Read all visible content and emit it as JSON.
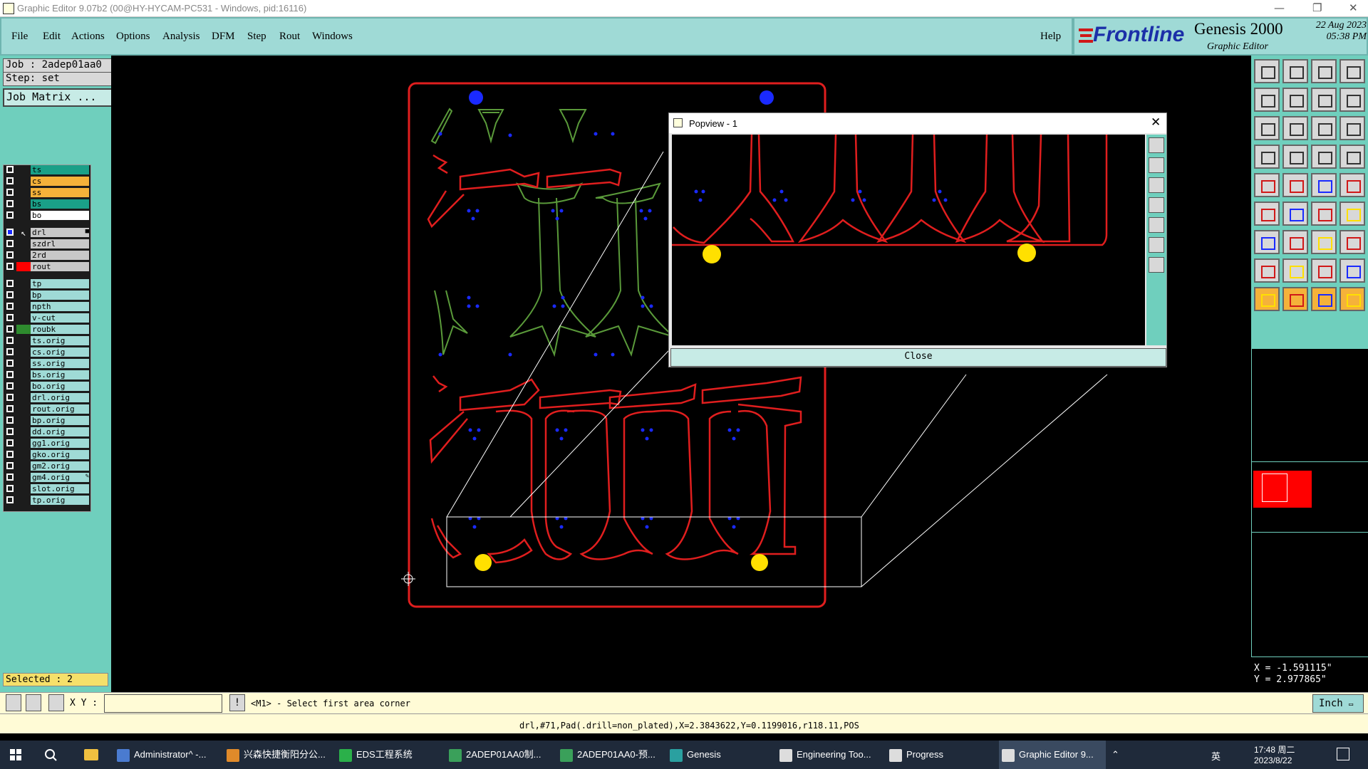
{
  "window": {
    "title": "Graphic Editor 9.07b2 (00@HY-HYCAM-PC531 - Windows, pid:16116)",
    "minimize": "—",
    "restore": "❐",
    "close": "✕"
  },
  "menu": {
    "items": [
      "File",
      "Edit",
      "Actions",
      "Options",
      "Analysis",
      "DFM",
      "Step",
      "Rout",
      "Windows"
    ],
    "help": "Help"
  },
  "brand": {
    "logo": "Frontline",
    "product": "Genesis 2000",
    "subtitle": "Graphic Editor",
    "date": "22 Aug 2023",
    "time": "05:38 PM"
  },
  "job": {
    "job_label": "Job : 2adep01aa0",
    "step_label": "Step: set",
    "matrix_button": "Job Matrix ..."
  },
  "layers": [
    {
      "name": "ts",
      "color": "#1aa088",
      "mark": ""
    },
    {
      "name": "cs",
      "color": "#f5b23a",
      "mark": ""
    },
    {
      "name": "ss",
      "color": "#f5b23a",
      "mark": ""
    },
    {
      "name": "bs",
      "color": "#1aa088",
      "mark": ""
    },
    {
      "name": "bo",
      "color": "#ffffff",
      "mark": ""
    },
    {
      "name": "drl",
      "color": "#c8c8c8",
      "mark": "■",
      "active": true
    },
    {
      "name": "szdrl",
      "color": "#c8c8c8",
      "mark": ""
    },
    {
      "name": "2rd",
      "color": "#c8c8c8",
      "mark": ""
    },
    {
      "name": "rout",
      "color": "#c8c8c8",
      "mark": "",
      "display": "#ff0000"
    },
    {
      "name": "tp",
      "color": "#9fdad6",
      "mark": ""
    },
    {
      "name": "bp",
      "color": "#9fdad6",
      "mark": ""
    },
    {
      "name": "npth",
      "color": "#9fdad6",
      "mark": ""
    },
    {
      "name": "v-cut",
      "color": "#9fdad6",
      "mark": ""
    },
    {
      "name": "roubk",
      "color": "#9fdad6",
      "mark": "",
      "display": "#2e8b2e"
    },
    {
      "name": "ts.orig",
      "color": "#9fdad6",
      "mark": ""
    },
    {
      "name": "cs.orig",
      "color": "#9fdad6",
      "mark": ""
    },
    {
      "name": "ss.orig",
      "color": "#9fdad6",
      "mark": ""
    },
    {
      "name": "bs.orig",
      "color": "#9fdad6",
      "mark": ""
    },
    {
      "name": "bo.orig",
      "color": "#9fdad6",
      "mark": ""
    },
    {
      "name": "drl.orig",
      "color": "#9fdad6",
      "mark": ""
    },
    {
      "name": "rout.orig",
      "color": "#9fdad6",
      "mark": ""
    },
    {
      "name": "bp.orig",
      "color": "#9fdad6",
      "mark": ""
    },
    {
      "name": "dd.orig",
      "color": "#9fdad6",
      "mark": ""
    },
    {
      "name": "gg1.orig",
      "color": "#9fdad6",
      "mark": ""
    },
    {
      "name": "gko.orig",
      "color": "#9fdad6",
      "mark": ""
    },
    {
      "name": "gm2.orig",
      "color": "#9fdad6",
      "mark": ""
    },
    {
      "name": "gm4.orig",
      "color": "#9fdad6",
      "mark": "✎"
    },
    {
      "name": "slot.orig",
      "color": "#9fdad6",
      "mark": ""
    },
    {
      "name": "tp.orig",
      "color": "#9fdad6",
      "mark": ""
    }
  ],
  "selected_label": "Selected : 2",
  "popview": {
    "title": "Popview - 1",
    "close_button": "Close",
    "close_x": "✕"
  },
  "coords": {
    "x": "X = -1.591115\"",
    "y": "Y = 2.977865\""
  },
  "cmd": {
    "xy_label": "X Y :",
    "xy_value": "",
    "info_icon": "!",
    "prompt": "<M1> - Select first area corner",
    "unit": "Inch",
    "unit_arrow": "▭"
  },
  "status_text": "drl,#71,Pad(.drill=non_plated),X=2.3843622,Y=0.1199016,r118.11,POS",
  "taskbar": {
    "items": [
      {
        "label": "Administrator^ -...",
        "color": "#4a7bd0"
      },
      {
        "label": "兴森快捷衡阳分公...",
        "color": "#e08a2a"
      },
      {
        "label": "EDS工程系统",
        "color": "#2bb04a"
      },
      {
        "label": "2ADEP01AA0制...",
        "color": "#3aa05a"
      },
      {
        "label": "2ADEP01AA0-预...",
        "color": "#3aa05a"
      },
      {
        "label": "Genesis",
        "color": "#2aa0a0"
      },
      {
        "label": "Engineering Too...",
        "color": "#dddddd"
      },
      {
        "label": "Progress",
        "color": "#dddddd"
      },
      {
        "label": "Graphic Editor 9...",
        "color": "#dddddd"
      }
    ],
    "ime": "英",
    "clock_time": "17:48 周二",
    "clock_date": "2023/8/22",
    "tray_ime": "英"
  },
  "colors": {
    "panel": "#6fcfbd",
    "menubar": "#9fdad6",
    "rout": "#e01e1e",
    "board_green": "#5a9a3a",
    "drill_blue": "#1a2aff",
    "fiducial_yellow": "#ffe000"
  }
}
